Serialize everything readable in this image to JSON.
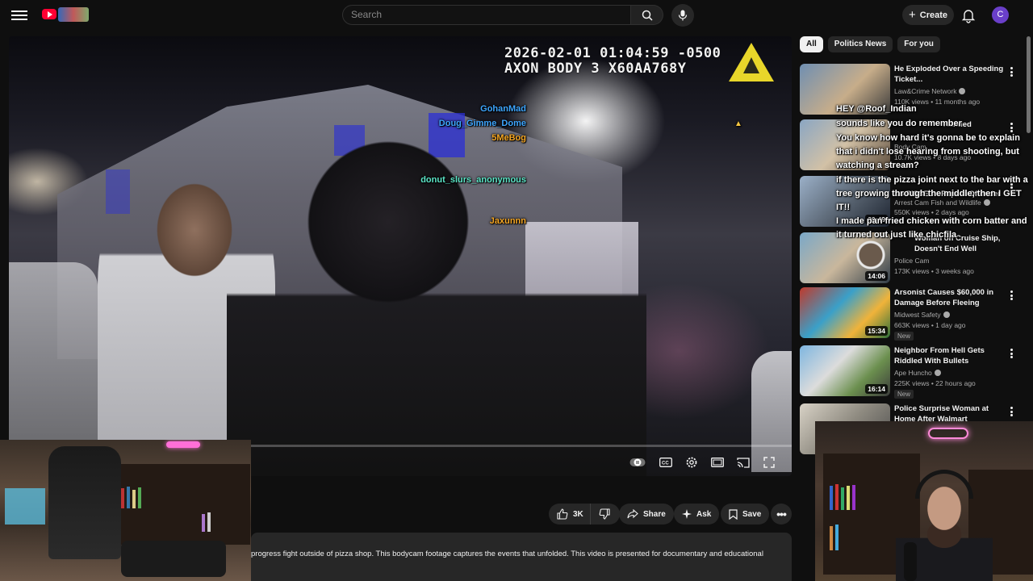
{
  "topbar": {
    "search_placeholder": "Search",
    "create_label": "Create",
    "avatar_letter": "C"
  },
  "player": {
    "timestamp_line1": "2026-02-01 01:04:59 -0500",
    "timestamp_line2": "AXON BODY 3 X60AA768Y",
    "progress_fraction": 0.0
  },
  "actions": {
    "like_count": "3K",
    "share_label": "Share",
    "ask_label": "Ask",
    "save_label": "Save"
  },
  "description": {
    "text": "progress fight outside of pizza shop. This bodycam footage captures the events that unfolded. This video is presented for documentary and educational"
  },
  "chips": [
    {
      "label": "All",
      "active": true
    },
    {
      "label": "Politics News",
      "active": false
    },
    {
      "label": "For you",
      "active": false
    }
  ],
  "recommendations": [
    {
      "title": "He Exploded Over a Speeding Ticket...",
      "channel": "Law&Crime Network",
      "meta": "110K views • 11 months ago",
      "duration": "",
      "badge": ""
    },
    {
      "title": "Handed",
      "channel": "Body Cam...",
      "meta": "10.7K views • 8 days ago",
      "duration": "",
      "badge": ""
    },
    {
      "title": "So PISSED - Repeat Offender",
      "channel": "Arrest Cam Fish and Wildlife",
      "meta": "550K views • 2 days ago",
      "duration": "30:49",
      "badge": ""
    },
    {
      "title": "Woman on Cruise Ship, Doesn't End Well",
      "channel": "Police Cam",
      "meta": "173K views • 3 weeks ago",
      "duration": "14:06",
      "badge": ""
    },
    {
      "title": "Arsonist Causes $60,000 in Damage Before Fleeing",
      "channel": "Midwest Safety",
      "meta": "663K views • 1 day ago",
      "duration": "15:34",
      "badge": "New"
    },
    {
      "title": "Neighbor From Hell Gets Riddled With Bullets",
      "channel": "Ape Huncho",
      "meta": "225K views • 22 hours ago",
      "duration": "16:14",
      "badge": "New"
    },
    {
      "title": "Police Surprise Woman at Home After Walmart Shoplifti...",
      "channel": "",
      "meta": "",
      "duration": "",
      "badge": ""
    }
  ],
  "chat": [
    {
      "user": "GohanMad",
      "user_color": "#3ea6ff",
      "message": "HEY @Roof_Indian"
    },
    {
      "user": "Doug_Gimme_Dome",
      "user_color": "#3ea6ff",
      "message": "sounds like you do remember"
    },
    {
      "user": "5MeBog",
      "user_color": "#f5a623",
      "message": "You know how hard it's gonna be to explain that i didn't lose hearing from shooting, but watching a stream?"
    },
    {
      "user": "donut_slurs_anonymous",
      "user_color": "#5ce6c8",
      "message": "if there is the pizza joint next to the bar with a tree growing through the middle, then I GET IT!!"
    },
    {
      "user": "Jaxunnn",
      "user_color": "#f5a623",
      "message": "I made pan fried chicken with corn batter and it turned out just like chicfila"
    }
  ]
}
